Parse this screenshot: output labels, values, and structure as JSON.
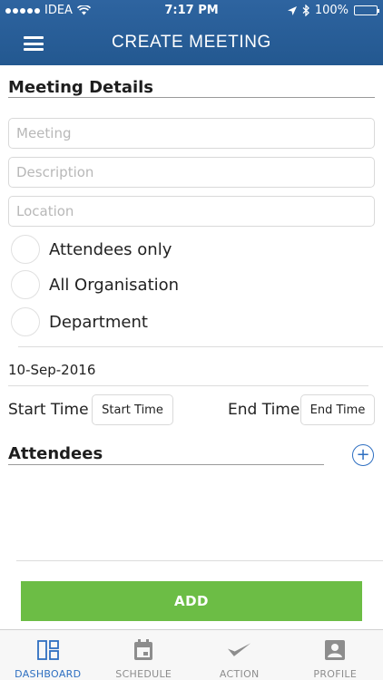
{
  "status_bar": {
    "carrier": "IDEA",
    "time": "7:17 PM",
    "battery": "100%",
    "battery_level": 1.0
  },
  "header": {
    "title": "CREATE MEETING"
  },
  "meeting_details": {
    "title": "Meeting Details",
    "meeting_placeholder": "Meeting",
    "description_placeholder": "Description",
    "location_placeholder": "Location",
    "visibility_options": [
      "Attendees only",
      "All Organisation",
      "Department"
    ]
  },
  "schedule": {
    "date": "10-Sep-2016",
    "start_label": "Start Time",
    "start_button": "Start Time",
    "end_label": "End Time",
    "end_button": "End Time"
  },
  "attendees": {
    "title": "Attendees"
  },
  "add_button": "ADD",
  "tabs": [
    {
      "label": "DASHBOARD",
      "icon": "dashboard-icon",
      "active": true
    },
    {
      "label": "SCHEDULE",
      "icon": "calendar-icon",
      "active": false
    },
    {
      "label": "ACTION",
      "icon": "checkmark-icon",
      "active": false
    },
    {
      "label": "PROFILE",
      "icon": "profile-icon",
      "active": false
    }
  ],
  "colors": {
    "header": "#2a5e98",
    "accent": "#2e6fc1",
    "add_button": "#6cbd45"
  }
}
